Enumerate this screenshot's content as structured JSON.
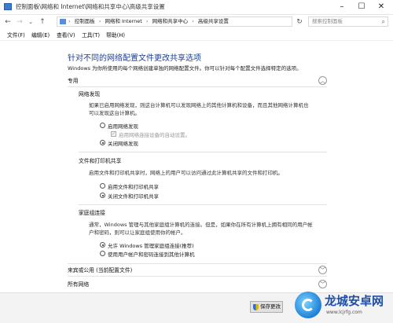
{
  "window": {
    "title": "控制面板\\网络和 Internet\\网络和共享中心\\高级共享设置",
    "controls": {
      "minimize": "–",
      "maximize": "☐",
      "close": "✕"
    }
  },
  "address": {
    "crumbs": [
      "控制面板",
      "网络和 Internet",
      "网络和共享中心",
      "高级共享设置"
    ],
    "separator": "›",
    "search_placeholder": "搜索控制面板"
  },
  "menu": [
    "文件(F)",
    "编辑(E)",
    "查看(V)",
    "工具(T)",
    "帮助(H)"
  ],
  "page": {
    "heading": "针对不同的网络配置文件更改共享选项",
    "intro": "Windows 为你所使用的每个网络创建单独的网络配置文件。你可以针对每个配置文件选择特定的选项。"
  },
  "sections": {
    "private": {
      "title": "专用",
      "chevron": "︿"
    },
    "guest": {
      "title": "来宾或公用 (当前配置文件)",
      "chevron": "﹀"
    },
    "all": {
      "title": "所有网络",
      "chevron": "﹀"
    }
  },
  "discovery": {
    "title": "网络发现",
    "desc_line1": "如果已启用网络发现，则这台计算机可以发现网络上的其他计算机和设备，而且其他网络计算机也",
    "desc_line2": "可以发现这台计算机。",
    "on_label": "启用网络发现",
    "auto_label": "启用网络连接设备的自动设置。",
    "off_label": "关闭网络发现",
    "selected": "off"
  },
  "fileprint": {
    "title": "文件和打印机共享",
    "desc": "启用文件和打印机共享时，网络上的用户可以访问通过此计算机共享的文件和打印机。",
    "on_label": "启用文件和打印机共享",
    "off_label": "关闭文件和打印机共享",
    "selected": "off"
  },
  "homegroup": {
    "title": "家庭组连接",
    "desc_line1": "通常，Windows 管理与其他家庭组计算机的连接。但是，如果你在所有计算机上拥有相同的用户帐",
    "desc_line2": "户和密码，则可以让家庭组使用你的帐户。",
    "allow_label": "允许 Windows 管理家庭组连接(推荐)",
    "account_label": "使用用户帐户和密码连接到其他计算机",
    "selected": "allow"
  },
  "footer": {
    "save_label": "保存更改"
  },
  "watermark": {
    "big": "龙城安卓网",
    "small": "www.lcjrfg.com"
  }
}
